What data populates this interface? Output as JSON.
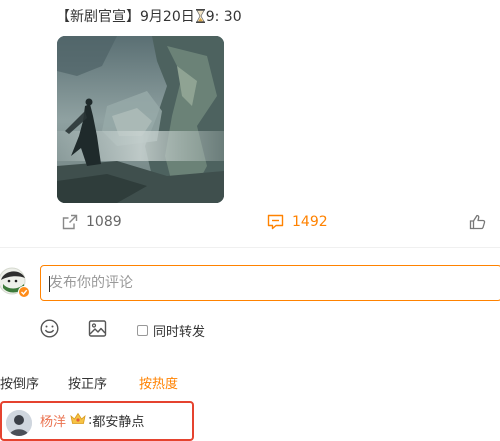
{
  "post": {
    "text_part1": "【新剧官宣】9月20日",
    "text_part2": "9: 30",
    "hourglass_icon": "hourglass-icon"
  },
  "actions": {
    "share_count": "1089",
    "comment_count": "1492",
    "share_icon": "share-icon",
    "comment_icon": "comment-icon",
    "like_icon": "thumbs-up-icon"
  },
  "compose": {
    "placeholder": "发布你的评论",
    "forward_label": "同时转发",
    "emoji_icon": "smiley-icon",
    "image_icon": "image-icon"
  },
  "sort": {
    "reverse": "按倒序",
    "forward": "按正序",
    "hot": "按热度"
  },
  "first_comment": {
    "user": "杨洋",
    "separator": ":",
    "text": "都安静点"
  },
  "colors": {
    "accent": "#ff8200",
    "highlight_border": "#e5432f",
    "username": "#eb7350"
  }
}
